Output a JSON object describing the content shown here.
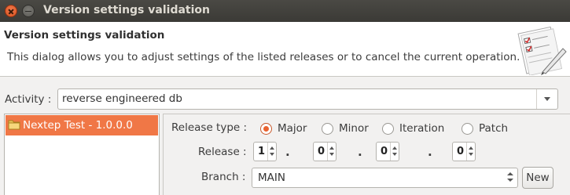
{
  "window": {
    "title": "Version settings validation"
  },
  "header": {
    "title": "Version settings validation",
    "description": "This dialog allows you to adjust settings of the listed releases or to cancel the current operation.",
    "icon": "checklist-document-icon"
  },
  "activity": {
    "label": "Activity :",
    "value": "reverse engineered db"
  },
  "releases": {
    "items": [
      {
        "label": "Nextep Test - 1.0.0.0",
        "icon": "folder-icon",
        "selected": true
      }
    ]
  },
  "release_type": {
    "label": "Release type :",
    "options": [
      {
        "label": "Major",
        "selected": true
      },
      {
        "label": "Minor",
        "selected": false
      },
      {
        "label": "Iteration",
        "selected": false
      },
      {
        "label": "Patch",
        "selected": false
      }
    ]
  },
  "release": {
    "label": "Release :",
    "parts": [
      "1",
      "0",
      "0",
      "0"
    ],
    "separator": "."
  },
  "branch": {
    "label": "Branch :",
    "value": "MAIN",
    "new_button": "New"
  },
  "colors": {
    "selection": "#f07746",
    "radio_accent": "#e9622f",
    "titlebar": "#3c3b37"
  }
}
